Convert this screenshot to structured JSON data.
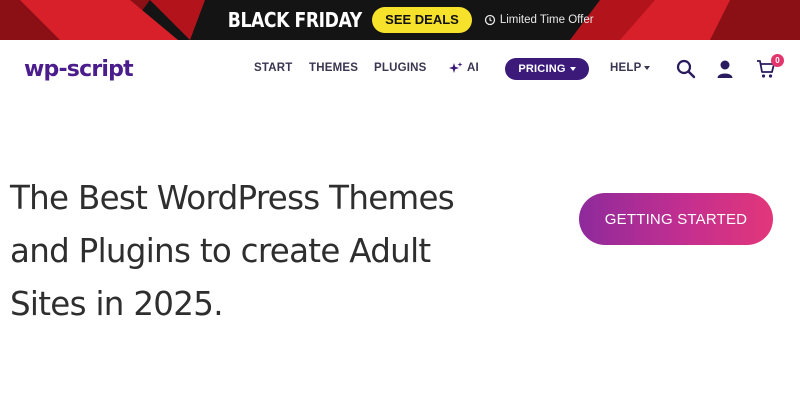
{
  "promo_banner": {
    "title": "BLACK FRIDAY",
    "cta_label": "SEE DEALS",
    "offer_text": "Limited Time Offer",
    "offer_icon": "tag-timer-icon",
    "colors": {
      "background": "#141414",
      "accent_red": "#d8202a",
      "cta_yellow": "#f7e22b"
    }
  },
  "header": {
    "logo_text": "wp-script",
    "nav": {
      "start": "START",
      "themes": "THEMES",
      "plugins": "PLUGINS",
      "ai": "AI",
      "pricing": "PRICING",
      "help": "HELP"
    },
    "icons": {
      "ai": "sparkle-icon",
      "search": "search-icon",
      "account": "user-icon",
      "cart": "cart-icon",
      "dropdown": "caret-down-icon"
    },
    "cart_count": "0",
    "colors": {
      "brand_purple": "#4a1c8c",
      "pricing_bg": "#3b1a7a",
      "badge": "#e2356c"
    }
  },
  "hero": {
    "title": "The Best WordPress Themes and Plugins to create Adult Sites in 2025.",
    "cta_label": "GETTING STARTED",
    "colors": {
      "cta_gradient_start": "#8e2a9c",
      "cta_gradient_end": "#e2367a"
    }
  }
}
